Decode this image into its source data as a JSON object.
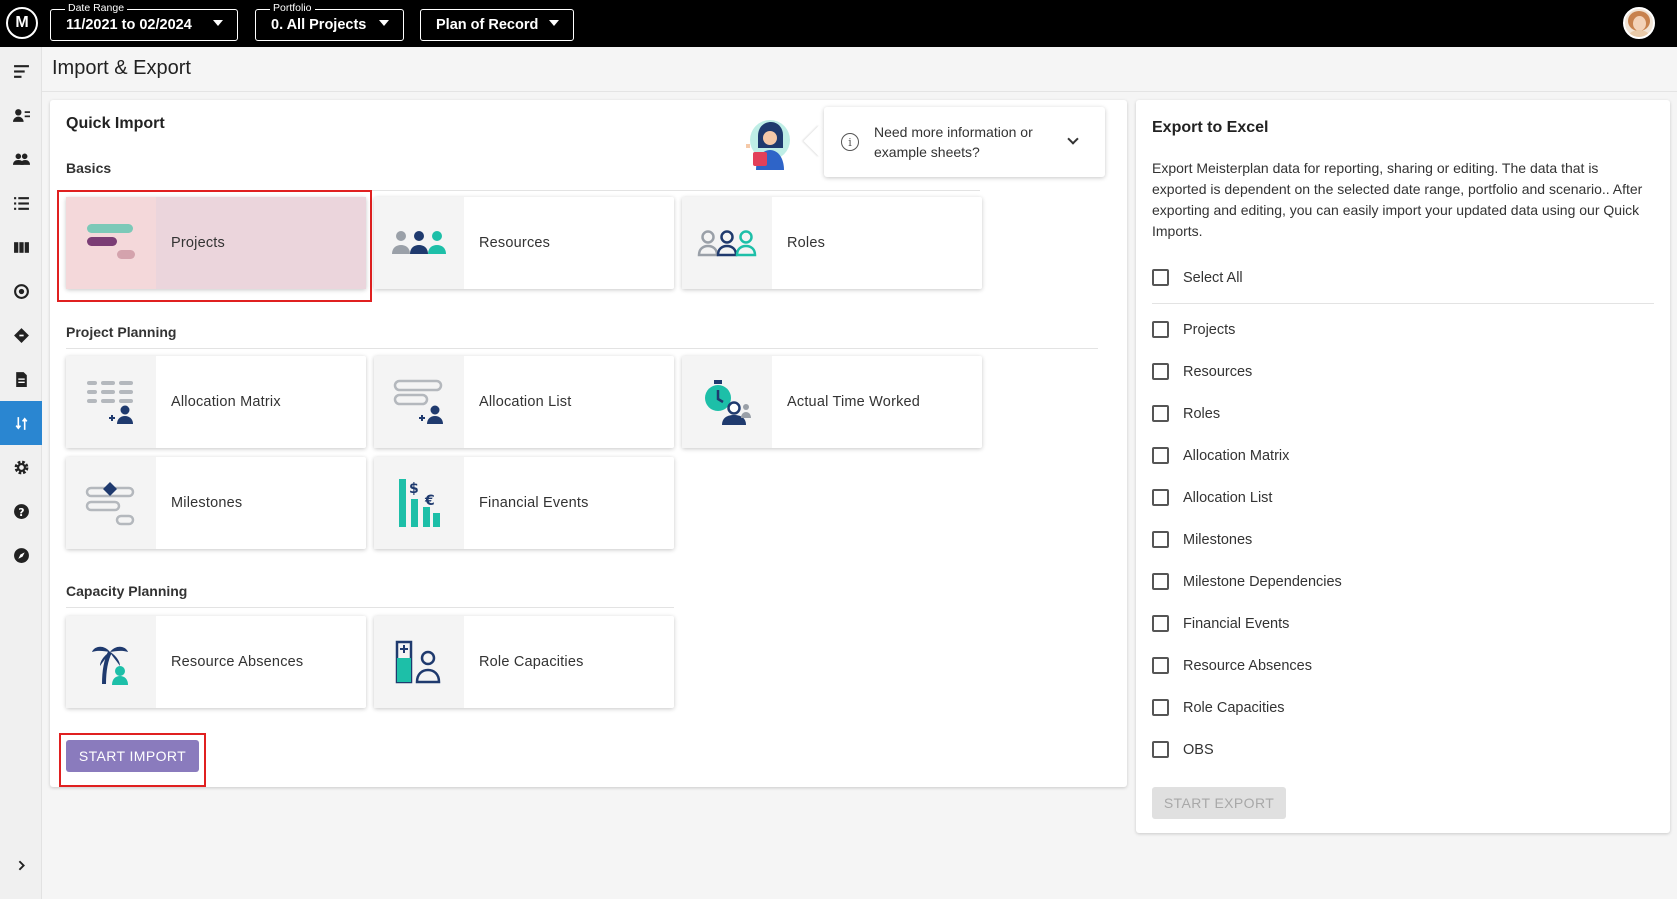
{
  "topbar": {
    "logo": "M",
    "date_range_label": "Date Range",
    "date_range_value": "11/2021 to 02/2024",
    "portfolio_label": "Portfolio",
    "portfolio_value": "0. All Projects",
    "scenario_value": "Plan of Record"
  },
  "page": {
    "title": "Import & Export"
  },
  "import": {
    "title": "Quick Import",
    "help_text": "Need more information or example sheets?",
    "sections": {
      "basics": "Basics",
      "project_planning": "Project Planning",
      "capacity_planning": "Capacity Planning"
    },
    "tiles": {
      "projects": "Projects",
      "resources": "Resources",
      "roles": "Roles",
      "allocation_matrix": "Allocation Matrix",
      "allocation_list": "Allocation List",
      "actual_time_worked": "Actual Time Worked",
      "milestones": "Milestones",
      "financial_events": "Financial Events",
      "resource_absences": "Resource Absences",
      "role_capacities": "Role Capacities"
    },
    "start_button": "START IMPORT"
  },
  "export": {
    "title": "Export to Excel",
    "description": "Export Meisterplan data for reporting, sharing or editing. The data that is exported is dependent on the selected date range, portfolio and scenario.. After exporting and editing, you can easily import your updated data using our Quick Imports.",
    "select_all": "Select All",
    "options": [
      "Projects",
      "Resources",
      "Roles",
      "Allocation Matrix",
      "Allocation List",
      "Milestones",
      "Milestone Dependencies",
      "Financial Events",
      "Resource Absences",
      "Role Capacities",
      "OBS"
    ],
    "start_button": "START EXPORT"
  },
  "colors": {
    "accent_blue": "#2a86d1",
    "primary_purple": "#8a7bbd",
    "navy": "#1f3a6e",
    "teal": "#1dbfa8",
    "highlight_red": "#e02020"
  },
  "icons": {
    "nav": [
      "menu-icon",
      "person-list-icon",
      "people-icon",
      "list-icon",
      "columns-icon",
      "target-icon",
      "diamond-icon",
      "document-icon",
      "import-export-icon",
      "gear-icon",
      "help-icon",
      "compass-icon",
      "chevron-right-icon"
    ]
  }
}
